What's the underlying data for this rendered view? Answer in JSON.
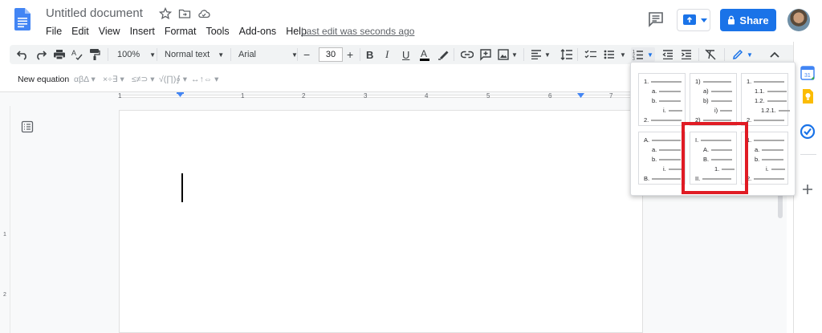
{
  "doc": {
    "title": "Untitled document",
    "last_edit": "Last edit was seconds ago"
  },
  "menu": [
    "File",
    "Edit",
    "View",
    "Insert",
    "Format",
    "Tools",
    "Add-ons",
    "Help"
  ],
  "share": {
    "label": "Share"
  },
  "toolbar": {
    "zoom": "100%",
    "style": "Normal text",
    "font": "Arial",
    "font_size": "30"
  },
  "equation_bar": {
    "new_equation": "New equation",
    "groups": [
      "αβΔ ▾",
      "×÷∃ ▾",
      "≤≠⊃ ▾",
      "√(∏)∮ ▾",
      "↔↑⇔ ▾"
    ]
  },
  "ruler": {
    "ticks": [
      "1",
      "1",
      "2",
      "3",
      "4",
      "5",
      "6",
      "7"
    ]
  },
  "vruler": {
    "ticks": [
      "1",
      "2"
    ]
  },
  "list_presets": [
    {
      "lines": [
        [
          "1.",
          ""
        ],
        [
          "a.",
          ""
        ],
        [
          "b.",
          ""
        ],
        [
          "i.",
          ""
        ],
        [
          "2.",
          ""
        ]
      ]
    },
    {
      "lines": [
        [
          "1)",
          ""
        ],
        [
          "a)",
          ""
        ],
        [
          "b)",
          ""
        ],
        [
          "i)",
          ""
        ],
        [
          "2)",
          ""
        ]
      ]
    },
    {
      "lines": [
        [
          "1.",
          ""
        ],
        [
          "1.1.",
          ""
        ],
        [
          "1.2.",
          ""
        ],
        [
          "1.2.1.",
          ""
        ],
        [
          "2.",
          ""
        ]
      ]
    },
    {
      "lines": [
        [
          "A.",
          ""
        ],
        [
          "a.",
          ""
        ],
        [
          "b.",
          ""
        ],
        [
          "i.",
          ""
        ],
        [
          "B.",
          ""
        ]
      ]
    },
    {
      "lines": [
        [
          "I.",
          ""
        ],
        [
          "A.",
          ""
        ],
        [
          "B.",
          ""
        ],
        [
          "1.",
          ""
        ],
        [
          "II.",
          ""
        ]
      ]
    },
    {
      "lines": [
        [
          "1.",
          ""
        ],
        [
          "a.",
          ""
        ],
        [
          "b.",
          ""
        ],
        [
          "i.",
          ""
        ],
        [
          "2.",
          ""
        ]
      ]
    }
  ],
  "colors": {
    "accent": "#1a73e8",
    "highlight": "#e01b24",
    "docs_blue": "#4285f4"
  }
}
